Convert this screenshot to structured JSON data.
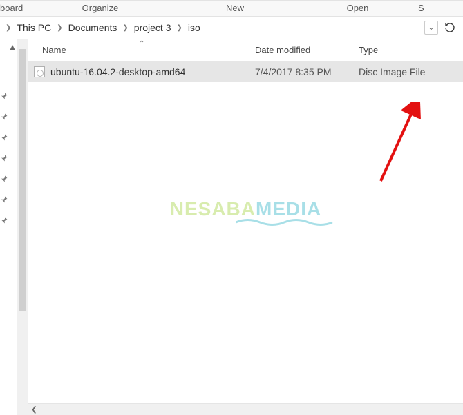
{
  "ribbon": {
    "tab_partial_left": "board",
    "tab_organize": "Organize",
    "tab_new": "New",
    "tab_open": "Open",
    "tab_partial_right": "S"
  },
  "breadcrumb": {
    "items": [
      "This PC",
      "Documents",
      "project 3",
      "iso"
    ]
  },
  "columns": {
    "name": "Name",
    "date": "Date modified",
    "type": "Type"
  },
  "files": [
    {
      "name": "ubuntu-16.04.2-desktop-amd64",
      "date": "7/4/2017 8:35 PM",
      "type": "Disc Image File"
    }
  ],
  "watermark": {
    "part1": "NESABA",
    "part2": "MEDIA"
  }
}
